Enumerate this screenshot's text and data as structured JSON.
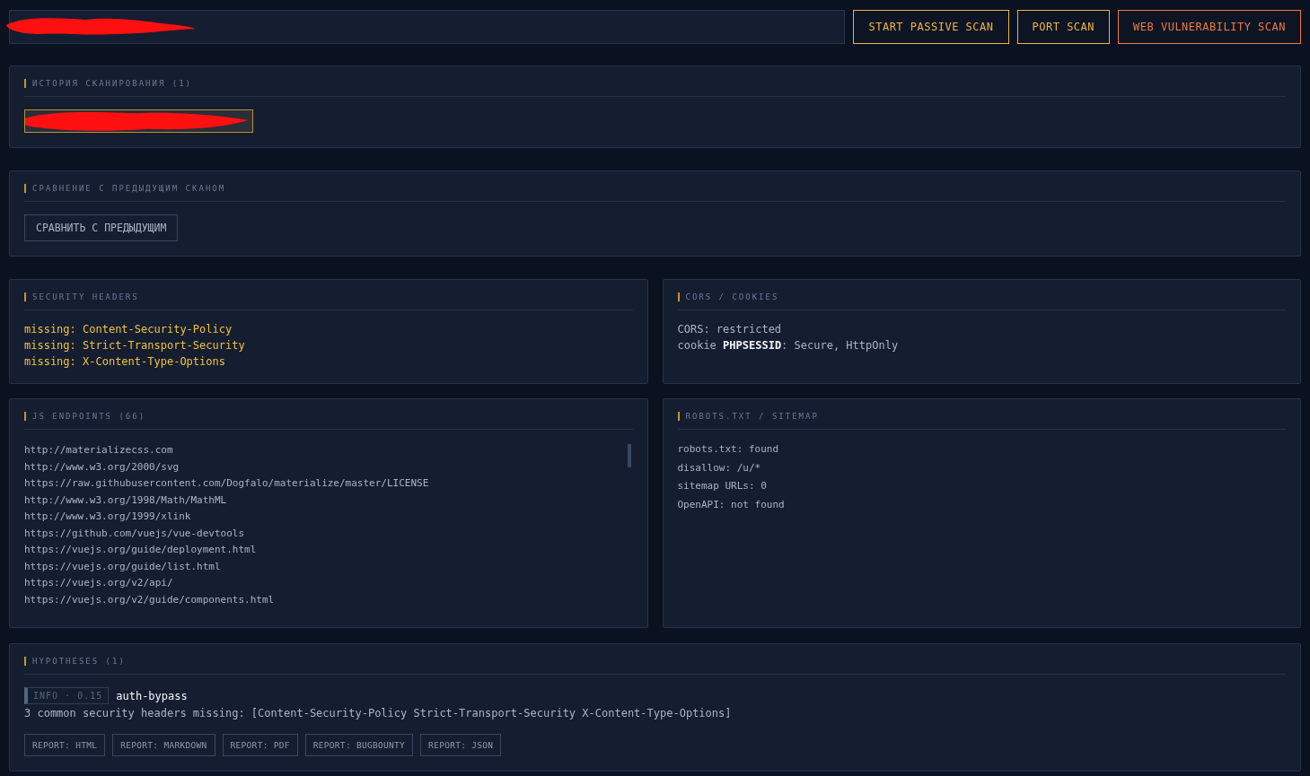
{
  "toolbar": {
    "buttons": [
      {
        "label": "START PASSIVE SCAN",
        "kind": "primary"
      },
      {
        "label": "PORT SCAN",
        "kind": "primary"
      },
      {
        "label": "WEB VULNERABILITY SCAN",
        "kind": "danger"
      }
    ]
  },
  "history": {
    "title": "ИСТОРИЯ СКАНИРОВАНИЯ (1)",
    "entries": [
      {
        "selected": true
      }
    ]
  },
  "compare": {
    "title": "СРАВНЕНИЕ С ПРЕДЫДУЩИМ СКАНОМ",
    "button": "СРАВНИТЬ С ПРЕДЫДУЩИМ"
  },
  "security_headers": {
    "title": "SECURITY HEADERS",
    "items": [
      {
        "label": "missing:",
        "value": "Content-Security-Policy"
      },
      {
        "label": "missing:",
        "value": "Strict-Transport-Security"
      },
      {
        "label": "missing:",
        "value": "X-Content-Type-Options"
      }
    ]
  },
  "cors_cookies": {
    "title": "CORS / COOKIES",
    "lines": [
      "CORS: restricted",
      "cookie **PHPSESSID**: Secure, HttpOnly"
    ]
  },
  "js_endpoints": {
    "title": "JS ENDPOINTS (66)",
    "items": [
      "http://materializecss.com",
      "http://www.w3.org/2000/svg",
      "https://raw.githubusercontent.com/Dogfalo/materialize/master/LICENSE",
      "http://www.w3.org/1998/Math/MathML",
      "http://www.w3.org/1999/xlink",
      "https://github.com/vuejs/vue-devtools",
      "https://vuejs.org/guide/deployment.html",
      "https://vuejs.org/guide/list.html",
      "https://vuejs.org/v2/api/",
      "https://vuejs.org/v2/guide/components.html"
    ]
  },
  "robots": {
    "title": "ROBOTS.TXT / SITEMAP",
    "lines": [
      "robots.txt: found",
      "disallow: /u/*",
      "sitemap URLs: 0",
      "OpenAPI: not found"
    ]
  },
  "hypotheses": {
    "title": "HYPOTHESES (1)",
    "items": [
      {
        "severity": "INFO",
        "separator": "·",
        "score": "0.15",
        "name": "auth-bypass",
        "description": "3 common security headers missing: [Content-Security-Policy Strict-Transport-Security X-Content-Type-Options]"
      }
    ],
    "reports": [
      "REPORT: HTML",
      "REPORT: MARKDOWN",
      "REPORT: PDF",
      "REPORT: BUGBOUNTY",
      "REPORT: JSON"
    ]
  }
}
